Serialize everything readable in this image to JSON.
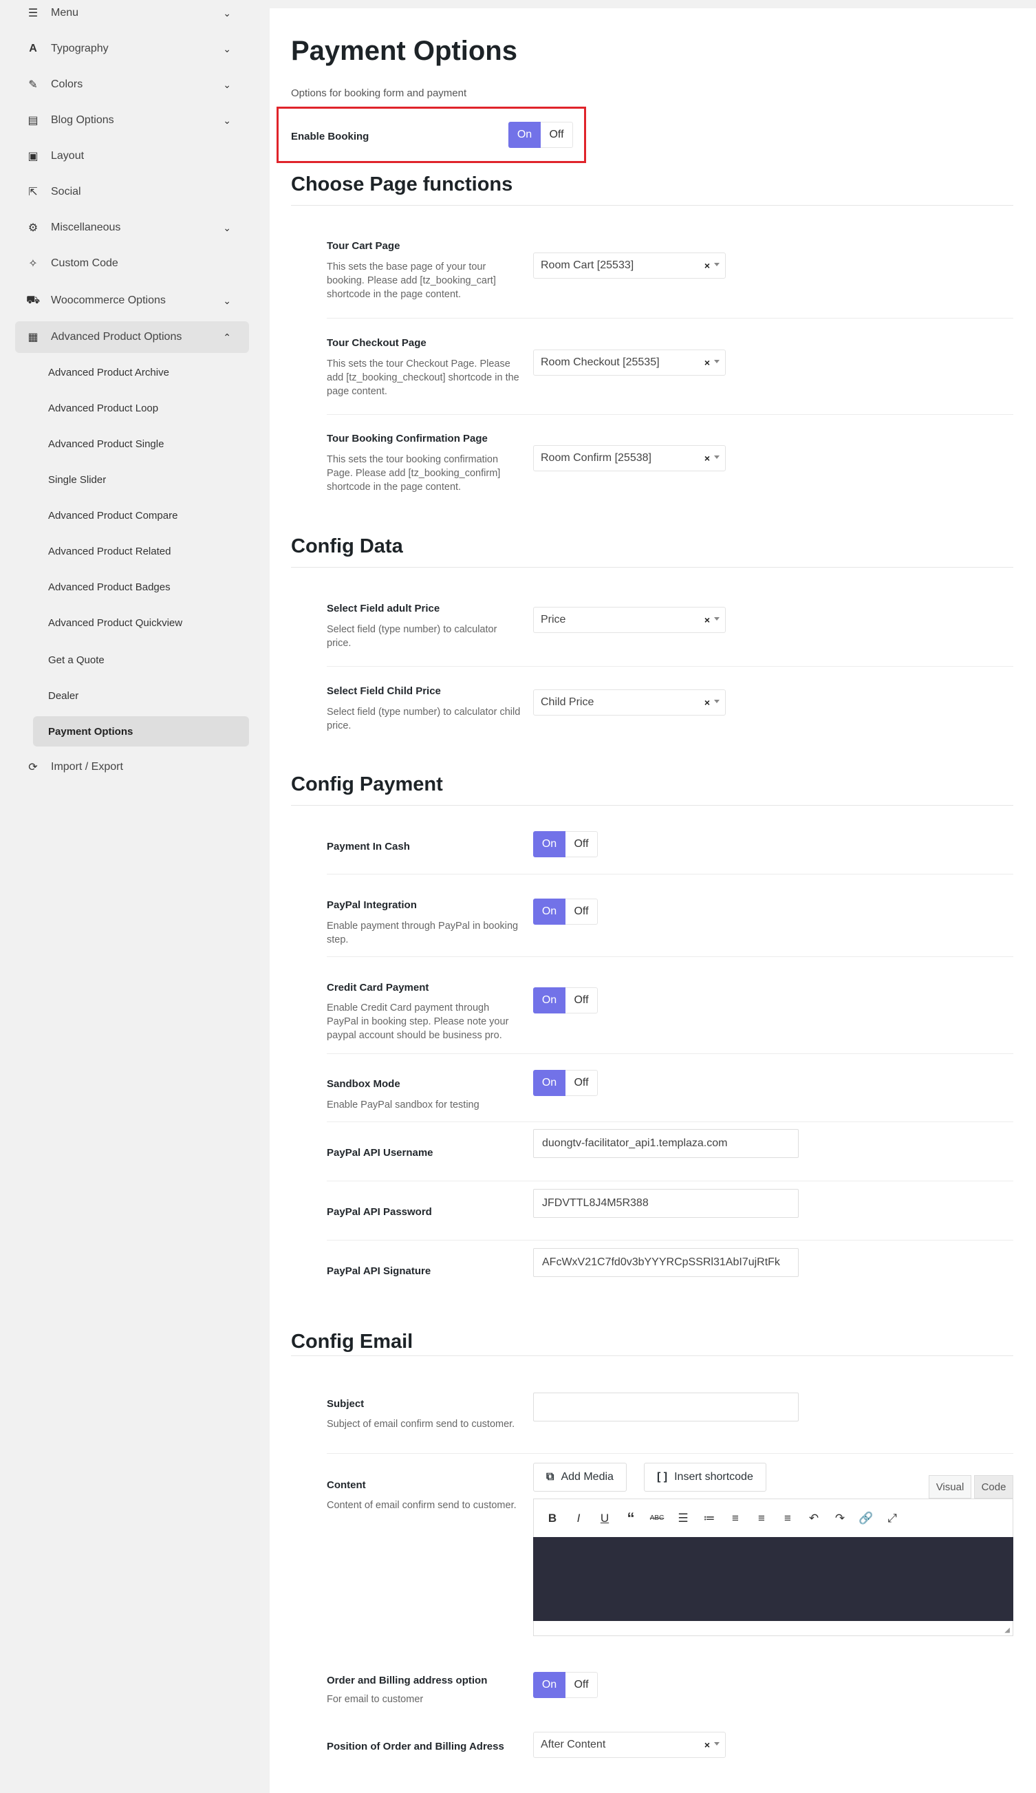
{
  "sidebar": {
    "items": [
      {
        "label": "Menu",
        "icon": "menu-icon",
        "glyph": "☰",
        "chevron": true
      },
      {
        "label": "Typography",
        "icon": "typography-icon",
        "glyph": "A",
        "chevron": true
      },
      {
        "label": "Colors",
        "icon": "brush-icon",
        "glyph": "✎",
        "chevron": true
      },
      {
        "label": "Blog Options",
        "icon": "book-icon",
        "glyph": "▤",
        "chevron": true
      },
      {
        "label": "Layout",
        "icon": "layout-icon",
        "glyph": "▣",
        "chevron": false
      },
      {
        "label": "Social",
        "icon": "share-icon",
        "glyph": "⇱",
        "chevron": false
      },
      {
        "label": "Miscellaneous",
        "icon": "cogs-icon",
        "glyph": "⚙",
        "chevron": true
      },
      {
        "label": "Custom Code",
        "icon": "magic-wand-icon",
        "glyph": "✧",
        "chevron": false
      },
      {
        "label": "Woocommerce Options",
        "icon": "cart-icon",
        "glyph": "🛒",
        "chevron": true
      },
      {
        "label": "Advanced Product Options",
        "icon": "grid-icon",
        "glyph": "▦",
        "chevron": true
      }
    ],
    "sub_items": [
      "Advanced Product Archive",
      "Advanced Product Loop",
      "Advanced Product Single",
      "Single Slider",
      "Advanced Product Compare",
      "Advanced Product Related",
      "Advanced Product Badges",
      "Advanced Product Quickview",
      "Get a Quote",
      "Dealer",
      "Payment Options"
    ],
    "import_export": "Import / Export"
  },
  "page": {
    "title": "Payment Options",
    "subtitle": "Options for booking form and payment",
    "enable_booking": "Enable Booking"
  },
  "toggle": {
    "on": "On",
    "off": "Off"
  },
  "sections": {
    "page_functions": "Choose Page functions",
    "config_data": "Config Data",
    "config_payment": "Config Payment",
    "config_email": "Config Email"
  },
  "page_functions": [
    {
      "label": "Tour Cart Page",
      "desc": "This sets the base page of your tour booking. Please add [tz_booking_cart] shortcode in the page content.",
      "value": "Room Cart [25533]"
    },
    {
      "label": "Tour Checkout Page",
      "desc": "This sets the tour Checkout Page. Please add [tz_booking_checkout] shortcode in the page content.",
      "value": "Room Checkout [25535]"
    },
    {
      "label": "Tour Booking Confirmation Page",
      "desc": "This sets the tour booking confirmation Page. Please add [tz_booking_confirm] shortcode in the page content.",
      "value": "Room Confirm [25538]"
    }
  ],
  "config_data": [
    {
      "label": "Select Field adult Price",
      "desc": "Select field (type number) to calculator price.",
      "value": "Price"
    },
    {
      "label": "Select Field Child Price",
      "desc": "Select field (type number) to calculator child price.",
      "value": "Child Price"
    }
  ],
  "config_payment": {
    "cash": {
      "label": "Payment In Cash"
    },
    "paypal": {
      "label": "PayPal Integration",
      "desc": "Enable payment through PayPal in booking step."
    },
    "credit": {
      "label": "Credit Card Payment",
      "desc": "Enable Credit Card payment through PayPal in booking step. Please note your paypal account should be business pro."
    },
    "sandbox": {
      "label": "Sandbox Mode",
      "desc": "Enable PayPal sandbox for testing"
    },
    "api_username": {
      "label": "PayPal API Username",
      "value": "duongtv-facilitator_api1.templaza.com"
    },
    "api_password": {
      "label": "PayPal API Password",
      "value": "JFDVTTL8J4M5R388"
    },
    "api_signature": {
      "label": "PayPal API Signature",
      "value": "AFcWxV21C7fd0v3bYYYRCpSSRl31AbI7ujRtFk"
    }
  },
  "config_email": {
    "subject": {
      "label": "Subject",
      "desc": "Subject of email confirm send to customer.",
      "value": ""
    },
    "content": {
      "label": "Content",
      "desc": "Content of email confirm send to customer."
    },
    "add_media": "Add Media",
    "insert_shortcode": "Insert shortcode",
    "tab_visual": "Visual",
    "tab_code": "Code",
    "order_billing": {
      "label": "Order and Billing address option",
      "desc": "For email to customer"
    },
    "position": {
      "label": "Position of Order and Billing Adress",
      "value": "After Content"
    }
  },
  "colors": {
    "accent": "#7272e8",
    "highlight": "#e0242b",
    "editor_bg": "#2c2d3c"
  }
}
